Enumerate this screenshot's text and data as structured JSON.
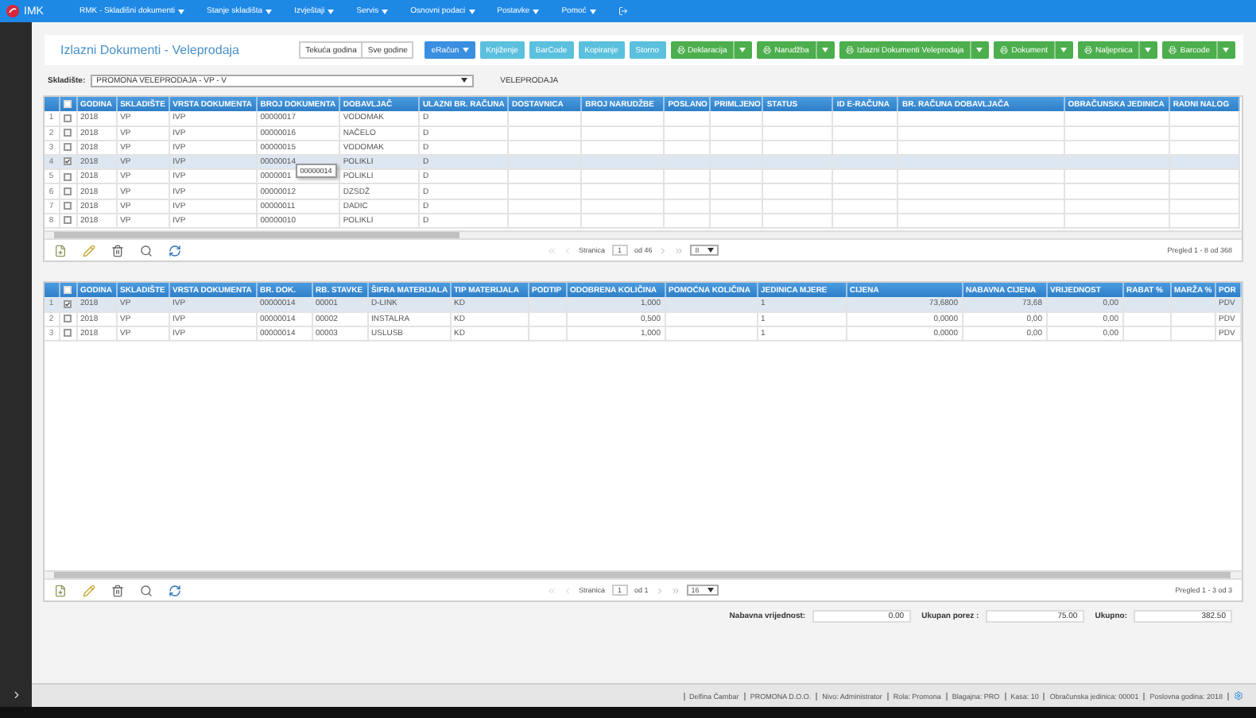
{
  "navbar": {
    "logo": "IMK",
    "menus": [
      {
        "label": "RMK - Skladišni dokumenti"
      },
      {
        "label": "Stanje skladišta"
      },
      {
        "label": "Izvještaji"
      },
      {
        "label": "Servis"
      },
      {
        "label": "Osnovni podaci"
      },
      {
        "label": "Postavke"
      },
      {
        "label": "Pomoć"
      }
    ]
  },
  "page": {
    "title": "Izlazni Dokumenti - Veleprodaja"
  },
  "year_buttons": [
    "Tekuća godina",
    "Sve godine"
  ],
  "action_buttons": [
    {
      "label": "eRačun",
      "kind": "dropdown"
    },
    {
      "label": "Knjiženje",
      "kind": "action"
    },
    {
      "label": "BarCode",
      "kind": "action"
    },
    {
      "label": "Kopiranje",
      "kind": "action"
    },
    {
      "label": "Storno",
      "kind": "action"
    },
    {
      "label": "Deklaracija",
      "kind": "print"
    },
    {
      "label": "Narudžba",
      "kind": "print"
    },
    {
      "label": "Izlazni Dokumenti Veleprodaja",
      "kind": "print"
    },
    {
      "label": "Dokument",
      "kind": "print"
    },
    {
      "label": "Naljepnica",
      "kind": "print"
    },
    {
      "label": "Barcode",
      "kind": "print"
    }
  ],
  "warehouse": {
    "label": "Skladište:",
    "value": "PROMONA VELEPRODAJA - VP - V",
    "note": "VELEPRODAJA"
  },
  "documents": {
    "all_checked": false,
    "columns": [
      "GODINA",
      "SKLADIŠTE",
      "VRSTA DOKUMENTA",
      "BROJ DOKUMENTA",
      "DOBAVLJAČ",
      "ULAZNI BR. RAČUNA",
      "DOSTAVNICA",
      "BROJ NARUDŽBE",
      "POSLANO",
      "PRIMLJENO",
      "STATUS",
      "ID E-RAČUNA",
      "BR. RAČUNA DOBAVLJAČA",
      "OBRAČUNSKA JEDINICA",
      "RADNI NALOG"
    ],
    "rows": [
      {
        "number": "1",
        "checked": false,
        "selected": false,
        "cells": [
          "2018",
          "VP",
          "IVP",
          "00000017",
          "VODOMAK",
          "D"
        ]
      },
      {
        "number": "2",
        "checked": false,
        "selected": false,
        "cells": [
          "2018",
          "VP",
          "IVP",
          "00000016",
          "NAČELO",
          "D"
        ]
      },
      {
        "number": "3",
        "checked": false,
        "selected": false,
        "cells": [
          "2018",
          "VP",
          "IVP",
          "00000015",
          "VODOMAK",
          "D"
        ]
      },
      {
        "number": "4",
        "checked": true,
        "selected": true,
        "cells": [
          "2018",
          "VP",
          "IVP",
          "00000014",
          "POLIKLI",
          "D"
        ]
      },
      {
        "number": "5",
        "checked": false,
        "selected": false,
        "cells": [
          "2018",
          "VP",
          "IVP",
          "0000001",
          "POLIKLI",
          "D"
        ]
      },
      {
        "number": "6",
        "checked": false,
        "selected": false,
        "cells": [
          "2018",
          "VP",
          "IVP",
          "00000012",
          "DZSDŽ",
          "D"
        ]
      },
      {
        "number": "7",
        "checked": false,
        "selected": false,
        "cells": [
          "2018",
          "VP",
          "IVP",
          "00000011",
          "DADIC",
          "D"
        ]
      },
      {
        "number": "8",
        "checked": false,
        "selected": false,
        "cells": [
          "2018",
          "VP",
          "IVP",
          "00000010",
          "POLIKLI",
          "D"
        ]
      }
    ],
    "tooltip": "00000014",
    "pager": {
      "label": "Stranica",
      "page": "1",
      "total": "od 46",
      "page_size": "8",
      "summary": "Pregled 1 - 8 od 368"
    }
  },
  "items": {
    "all_checked": false,
    "columns": [
      "GODINA",
      "SKLADIŠTE",
      "VRSTA DOKUMENTA",
      "BR. DOK.",
      "RB. STAVKE",
      "ŠIFRA MATERIJALA",
      "TIP MATERIJALA",
      "PODTIP",
      "ODOBRENA KOLIČINA",
      "POMOĆNA KOLIČINA",
      "JEDINICA MJERE",
      "CIJENA",
      "NABAVNA CIJENA",
      "VRIJEDNOST",
      "RABAT %",
      "MARŽA %",
      "POR"
    ],
    "rows": [
      {
        "number": "1",
        "checked": true,
        "selected": true,
        "cells": [
          "2018",
          "VP",
          "IVP",
          "00000014",
          "00001",
          "D-LINK",
          "KD",
          null,
          "1,000",
          null,
          "1",
          "73,6800",
          "73,68",
          "0,00",
          null,
          null,
          "PDV"
        ]
      },
      {
        "number": "2",
        "checked": false,
        "selected": false,
        "cells": [
          "2018",
          "VP",
          "IVP",
          "00000014",
          "00002",
          "INSTALRA",
          "KD",
          null,
          "0,500",
          null,
          "1",
          "0,0000",
          "0,00",
          "0,00",
          null,
          null,
          "PDV"
        ]
      },
      {
        "number": "3",
        "checked": false,
        "selected": false,
        "cells": [
          "2018",
          "VP",
          "IVP",
          "00000014",
          "00003",
          "USLUSB",
          "KD",
          null,
          "1,000",
          null,
          "1",
          "0,0000",
          "0,00",
          "0,00",
          null,
          null,
          "PDV"
        ]
      }
    ],
    "pager": {
      "label": "Stranica",
      "page": "1",
      "total": "od 1",
      "page_size": "16",
      "summary": "Pregled 1 - 3 od 3"
    }
  },
  "totals": [
    {
      "label": "Nabavna vrijednost:",
      "value": "0.00"
    },
    {
      "label": "Ukupan porez :",
      "value": "75.00"
    },
    {
      "label": "Ukupno:",
      "value": "382.50"
    }
  ],
  "status_bar": [
    "Delfina Čambar",
    "PROMONA D.O.O.",
    "Nivo: Administrator",
    "Rola: Promona",
    "Blagajna: PRO",
    "Kasa: 10",
    "Obračunska jedinica: 00001",
    "Poslovna godina: 2018"
  ]
}
